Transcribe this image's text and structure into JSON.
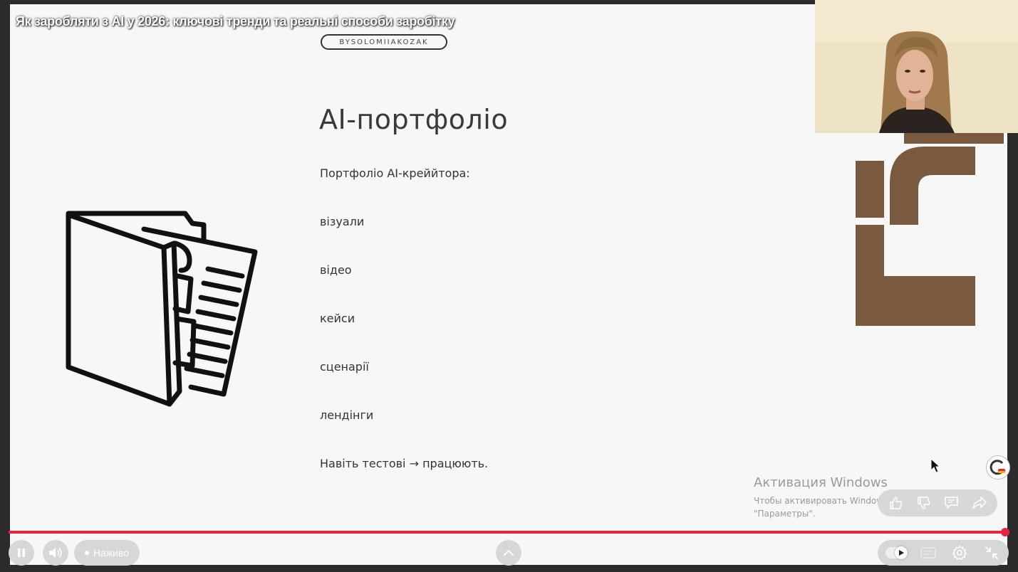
{
  "video": {
    "title": "Як заробляти з AI у 2026: ключові тренди та реальні способи заробітку",
    "progress_fraction": 1.0,
    "live_label": "Наживо"
  },
  "slide": {
    "brand": "BYSOLOMIIAKOZAK",
    "title": "AI-портфоліо",
    "subtitle": "Портфоліо AI-креййтора:",
    "items": [
      "візуали",
      "відео",
      "кейси",
      "сценарії",
      "лендінги"
    ],
    "footer": "Навіть тестові → працюють."
  },
  "watermark": {
    "line1": "Активация Windows",
    "line2": "Чтобы активировать Windows,",
    "line3": "\"Параметры\"."
  },
  "icons": {
    "pause": "pause-icon",
    "volume": "volume-icon",
    "chevron": "chevron-up-icon",
    "settings": "gear-icon",
    "fullscreen": "exit-fullscreen-icon",
    "like": "thumbs-up-icon",
    "dislike": "thumbs-down-icon",
    "comment": "comment-icon",
    "share": "share-icon",
    "folder": "folder-documents-icon"
  },
  "colors": {
    "accent": "#e8243c",
    "deco_brown": "#7a5a3e",
    "slide_bg": "#f7f7f7"
  }
}
